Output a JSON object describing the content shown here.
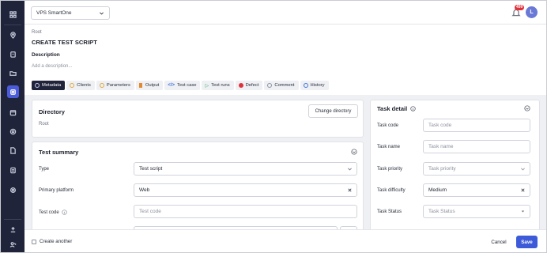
{
  "topbar": {
    "project": "VPS SmartOne",
    "notification_count": "499",
    "avatar_initial": "L"
  },
  "header": {
    "breadcrumb": "Root",
    "title": "CREATE TEST SCRIPT",
    "description_label": "Description",
    "description_placeholder": "Add a description..."
  },
  "tabs": [
    {
      "label": "Metadata",
      "icon": "tag-icon",
      "active": true
    },
    {
      "label": "Clients",
      "icon": "clients-icon"
    },
    {
      "label": "Parameters",
      "icon": "parameters-icon"
    },
    {
      "label": "Output",
      "icon": "output-icon"
    },
    {
      "label": "Test case",
      "icon": "code-icon"
    },
    {
      "label": "Test runs",
      "icon": "play-icon"
    },
    {
      "label": "Defect",
      "icon": "bug-icon"
    },
    {
      "label": "Comment",
      "icon": "comment-icon"
    },
    {
      "label": "History",
      "icon": "history-icon"
    }
  ],
  "directory": {
    "title": "Directory",
    "value": "Root",
    "change_button": "Change directory"
  },
  "test_summary": {
    "title": "Test summary",
    "fields": {
      "type_label": "Type",
      "type_value": "Test script",
      "platform_label": "Primary platform",
      "platform_value": "Web",
      "code_label": "Test code",
      "code_placeholder": "Test code"
    }
  },
  "task_detail": {
    "title": "Task detail",
    "fields": {
      "code_label": "Task code",
      "code_placeholder": "Task code",
      "name_label": "Task name",
      "name_placeholder": "Task name",
      "priority_label": "Task priority",
      "priority_placeholder": "Task priority",
      "difficulty_label": "Task difficulty",
      "difficulty_value": "Medium",
      "status_label": "Task Status",
      "status_placeholder": "Task Status"
    }
  },
  "footer": {
    "create_another": "Create another",
    "cancel": "Cancel",
    "save": "Save"
  }
}
